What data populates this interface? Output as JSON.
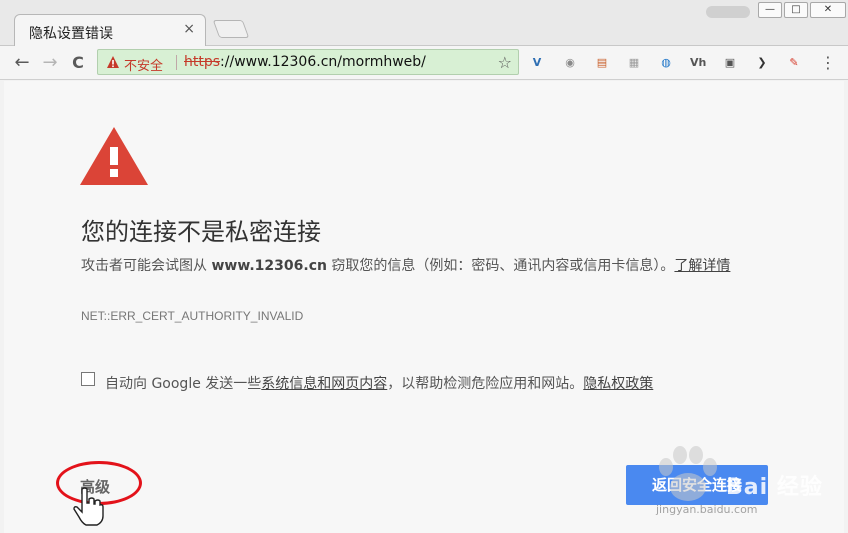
{
  "tab": {
    "title": "隐私设置错误",
    "close": "×"
  },
  "window": {
    "minimize": "—",
    "maximize": "□",
    "close": "✕"
  },
  "toolbar": {
    "back": "←",
    "forward": "→",
    "reload": "C",
    "security_label": "不安全",
    "url_scheme": "https",
    "url_rest": "://www.12306.cn/mormhweb/",
    "star": "☆",
    "menu": "⋮"
  },
  "extensions": [
    {
      "name": "extension-v-icon",
      "glyph": "V",
      "color": "#2f6fb3"
    },
    {
      "name": "extension-globe-icon",
      "glyph": "◉",
      "color": "#8a8a8a"
    },
    {
      "name": "extension-calendar-icon",
      "glyph": "▤",
      "color": "#c9602a"
    },
    {
      "name": "extension-page-icon",
      "glyph": "▦",
      "color": "#9a9a9a"
    },
    {
      "name": "extension-search-icon",
      "glyph": "◍",
      "color": "#1a73c8"
    },
    {
      "name": "extension-vh-icon",
      "glyph": "Vh",
      "color": "#555555"
    },
    {
      "name": "extension-box-icon",
      "glyph": "▣",
      "color": "#555555"
    },
    {
      "name": "extension-arrow-icon",
      "glyph": "❯",
      "color": "#333333"
    },
    {
      "name": "extension-red-icon",
      "glyph": "✎",
      "color": "#d63b2b"
    }
  ],
  "page": {
    "heading": "您的连接不是私密连接",
    "desc_prefix": "攻击者可能会试图从 ",
    "desc_host": "www.12306.cn",
    "desc_suffix": " 窃取您的信息（例如：密码、通讯内容或信用卡信息）。",
    "learn_more": "了解详情",
    "error_code": "NET::ERR_CERT_AUTHORITY_INVALID",
    "checkbox_prefix": "自动向 Google 发送一些",
    "checkbox_link": "系统信息和网页内容",
    "checkbox_middle": "，以帮助检测危险应用和网站。",
    "privacy_link": "隐私权政策",
    "advanced": "高级",
    "back_to_safety": "返回安全连接"
  },
  "watermark": {
    "text": "Bai 经验",
    "sub": "jingyan.baidu.com"
  },
  "colors": {
    "accent": "#4a89f0",
    "warning_red": "#db4437",
    "omnibox_bg": "#d8f0d4",
    "annotation_red": "#e3121a"
  }
}
